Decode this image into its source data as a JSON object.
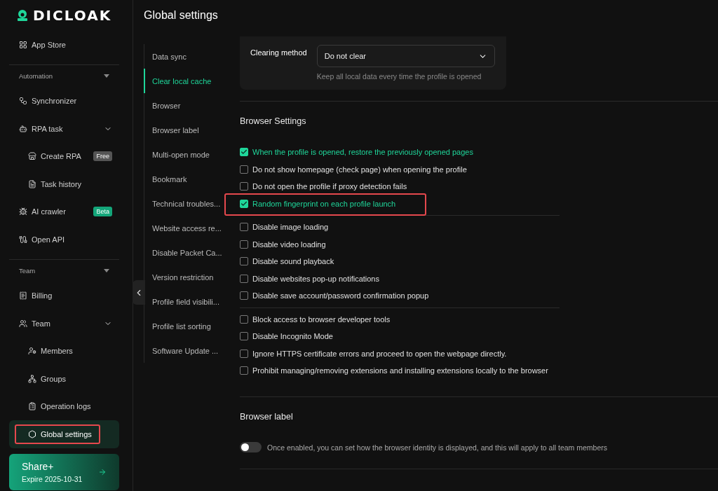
{
  "brand": {
    "name": "DICLOAK"
  },
  "sidebar": {
    "items": [
      {
        "kind": "link",
        "label": "App Store",
        "selected": false
      },
      {
        "kind": "divider"
      },
      {
        "kind": "section",
        "label": "Automation",
        "expanded": true
      },
      {
        "kind": "link",
        "label": "Synchronizer",
        "selected": false
      },
      {
        "kind": "group",
        "label": "RPA task",
        "expanded": true,
        "children": [
          {
            "label": "Create RPA",
            "badge": {
              "text": "Free",
              "color": "#555555"
            },
            "selected": false
          },
          {
            "label": "Task history",
            "selected": false
          }
        ]
      },
      {
        "kind": "link",
        "label": "AI crawler",
        "badge": {
          "text": "Beta",
          "color": "#14a67a"
        },
        "selected": false
      },
      {
        "kind": "link",
        "label": "Open API",
        "selected": false
      },
      {
        "kind": "divider"
      },
      {
        "kind": "section",
        "label": "Team",
        "expanded": true
      },
      {
        "kind": "link",
        "label": "Billing",
        "selected": false
      },
      {
        "kind": "group",
        "label": "Team",
        "expanded": true,
        "children": [
          {
            "label": "Members",
            "selected": false
          },
          {
            "label": "Groups",
            "selected": false
          },
          {
            "label": "Operation logs",
            "selected": false
          },
          {
            "label": "Global settings",
            "selected": true,
            "highlighted": true
          }
        ]
      }
    ]
  },
  "plan": {
    "name": "Share+",
    "expiry": "Expire 2025-10-31"
  },
  "page": {
    "title": "Global settings"
  },
  "subnav": [
    {
      "label": "Data sync",
      "selected": false
    },
    {
      "label": "Clear local cache",
      "selected": true
    },
    {
      "label": "Browser",
      "selected": false
    },
    {
      "label": "Browser label",
      "selected": false
    },
    {
      "label": "Multi-open mode",
      "selected": false
    },
    {
      "label": "Bookmark",
      "selected": false
    },
    {
      "label": "Technical troubles...",
      "selected": false
    },
    {
      "label": "Website access re...",
      "selected": false
    },
    {
      "label": "Disable Packet Ca...",
      "selected": false
    },
    {
      "label": "Version restriction",
      "selected": false
    },
    {
      "label": "Profile field visibili...",
      "selected": false
    },
    {
      "label": "Profile list sorting",
      "selected": false
    },
    {
      "label": "Software Update ...",
      "selected": false
    }
  ],
  "clearing": {
    "label": "Clearing method",
    "value": "Do not clear",
    "hint": "Keep all local data every time the profile is opened"
  },
  "browser_settings": {
    "title": "Browser Settings",
    "groups": [
      [
        {
          "label": "When the profile is opened, restore the previously opened pages",
          "checked": true
        },
        {
          "label": "Do not show homepage (check page) when opening the profile",
          "checked": false
        },
        {
          "label": "Do not open the profile if proxy detection fails",
          "checked": false
        },
        {
          "label": "Random fingerprint on each profile launch",
          "checked": true,
          "highlighted": true
        }
      ],
      [
        {
          "label": "Disable image loading",
          "checked": false
        },
        {
          "label": "Disable video loading",
          "checked": false
        },
        {
          "label": "Disable sound playback",
          "checked": false
        },
        {
          "label": "Disable websites pop-up notifications",
          "checked": false
        },
        {
          "label": "Disable save account/password confirmation popup",
          "checked": false
        }
      ],
      [
        {
          "label": "Block access to browser developer tools",
          "checked": false
        },
        {
          "label": "Disable Incognito Mode",
          "checked": false
        },
        {
          "label": "Ignore HTTPS certificate errors and proceed to open the webpage directly.",
          "checked": false
        },
        {
          "label": "Prohibit managing/removing extensions and installing extensions locally to the browser",
          "checked": false
        }
      ]
    ]
  },
  "browser_label": {
    "title": "Browser label",
    "on": false,
    "description": "Once enabled, you can set how the browser identity is displayed, and this will apply to all team members"
  }
}
